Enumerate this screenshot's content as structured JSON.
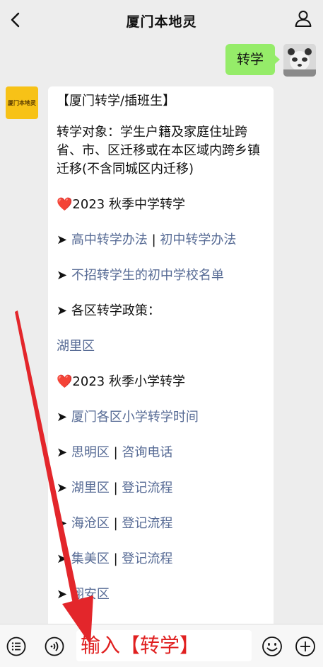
{
  "header": {
    "title": "厦门本地灵",
    "back_icon": "chevron-left-icon",
    "profile_icon": "person-icon"
  },
  "outgoing": {
    "text": "转学"
  },
  "bot": {
    "avatar_text": "厦门本地灵",
    "heading": "【厦门转学/插班生】",
    "intro": "转学对象：学生户籍及家庭住址跨省、市、区迁移或在本区域内跨乡镇迁移(不含同城区内迁移)",
    "middle_section": "2023 秋季中学转学",
    "high_school_link": "高中转学办法",
    "sep": "|",
    "junior_link": "初中转学办法",
    "no_transfer_link": "不招转学生的初中学校名单",
    "policy_label": "各区转学政策：",
    "huli_link": "湖里区",
    "primary_section": "2023 秋季小学转学",
    "primary_time_link": "厦门各区小学转学时间",
    "siming_link": "思明区",
    "consult_link": "咨询电话",
    "huli2_link": "湖里区",
    "register1_link": "登记流程",
    "haicang_link": "海沧区",
    "register2_link": "登记流程",
    "jimei_link": "集美区",
    "register3_link": "登记流程",
    "xiangan_link": "翔安区",
    "arrow": "➤",
    "heart": "❤️"
  },
  "input": {
    "text": "输入【转学】"
  },
  "colors": {
    "bubble_out": "#95ec69",
    "link": "#576b95",
    "annotation": "#e02020"
  }
}
